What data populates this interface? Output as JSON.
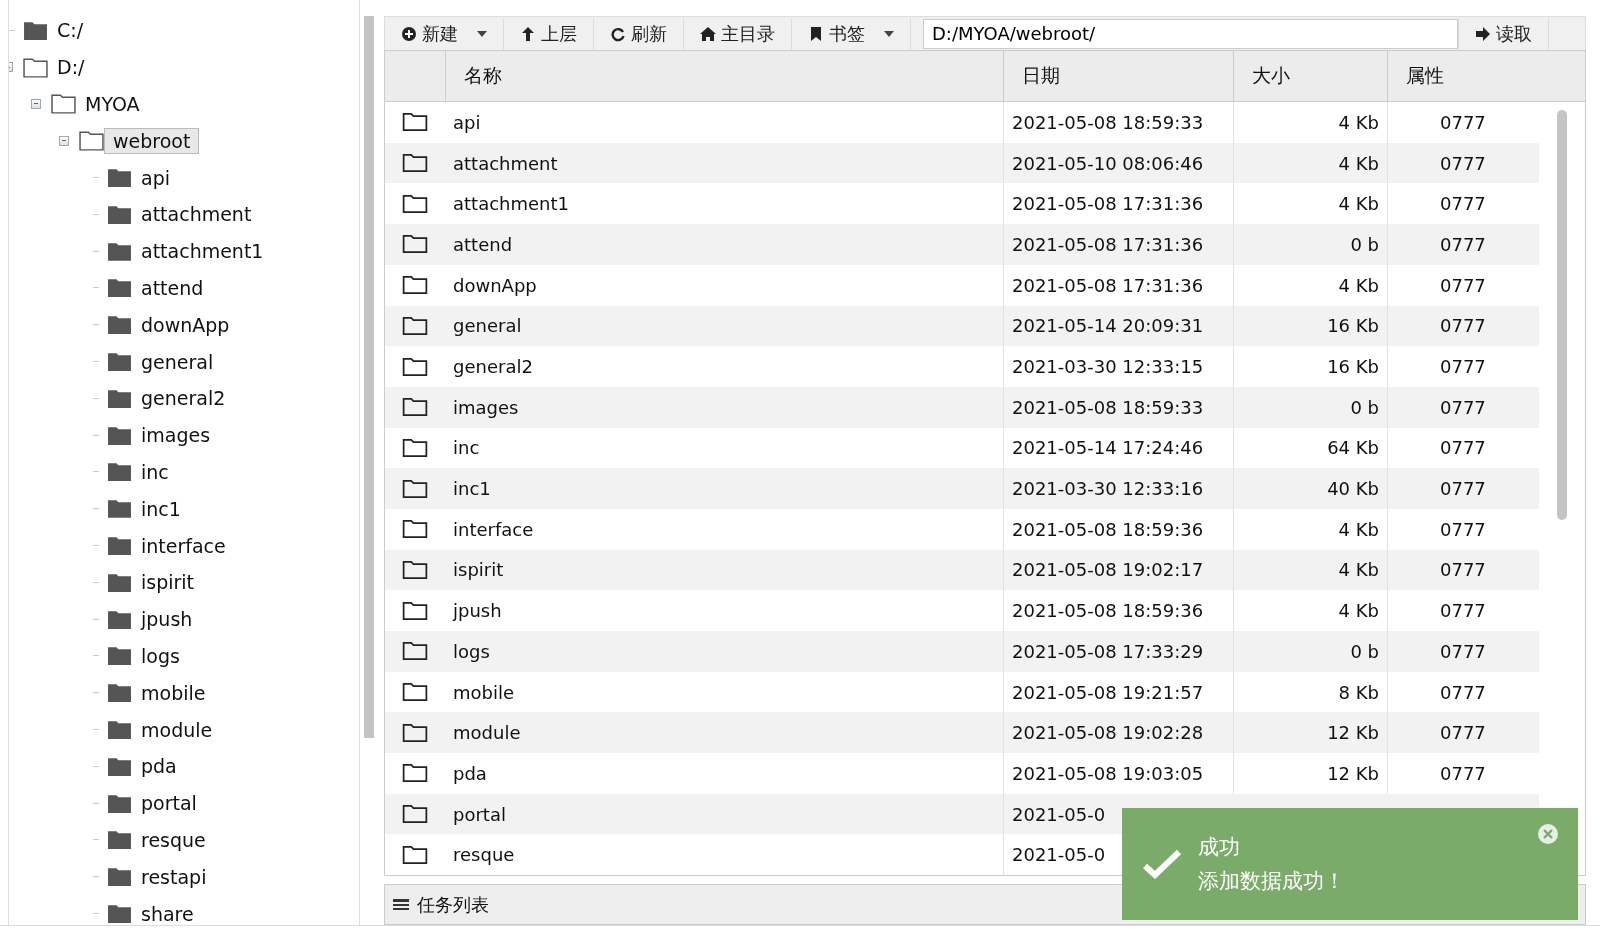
{
  "tree": [
    {
      "label": "C:/",
      "expanded": false,
      "selected": false
    },
    {
      "label": "D:/",
      "expanded": true,
      "selected": false,
      "children": [
        {
          "label": "MYOA",
          "expanded": true,
          "selected": false,
          "children": [
            {
              "label": "webroot",
              "expanded": true,
              "selected": true,
              "children": [
                {
                  "label": "api",
                  "expanded": false,
                  "selected": false
                },
                {
                  "label": "attachment",
                  "expanded": false,
                  "selected": false
                },
                {
                  "label": "attachment1",
                  "expanded": false,
                  "selected": false
                },
                {
                  "label": "attend",
                  "expanded": false,
                  "selected": false
                },
                {
                  "label": "downApp",
                  "expanded": false,
                  "selected": false
                },
                {
                  "label": "general",
                  "expanded": false,
                  "selected": false
                },
                {
                  "label": "general2",
                  "expanded": false,
                  "selected": false
                },
                {
                  "label": "images",
                  "expanded": false,
                  "selected": false
                },
                {
                  "label": "inc",
                  "expanded": false,
                  "selected": false
                },
                {
                  "label": "inc1",
                  "expanded": false,
                  "selected": false
                },
                {
                  "label": "interface",
                  "expanded": false,
                  "selected": false
                },
                {
                  "label": "ispirit",
                  "expanded": false,
                  "selected": false
                },
                {
                  "label": "jpush",
                  "expanded": false,
                  "selected": false
                },
                {
                  "label": "logs",
                  "expanded": false,
                  "selected": false
                },
                {
                  "label": "mobile",
                  "expanded": false,
                  "selected": false
                },
                {
                  "label": "module",
                  "expanded": false,
                  "selected": false
                },
                {
                  "label": "pda",
                  "expanded": false,
                  "selected": false
                },
                {
                  "label": "portal",
                  "expanded": false,
                  "selected": false
                },
                {
                  "label": "resque",
                  "expanded": false,
                  "selected": false
                },
                {
                  "label": "restapi",
                  "expanded": false,
                  "selected": false
                },
                {
                  "label": "share",
                  "expanded": false,
                  "selected": false
                }
              ]
            }
          ]
        }
      ]
    }
  ],
  "toolbar": [
    {
      "label": "新建",
      "dropdown": true
    },
    {
      "label": "上层",
      "dropdown": false
    },
    {
      "label": "刷新",
      "dropdown": false
    },
    {
      "label": "主目录",
      "dropdown": false
    },
    {
      "label": "书签",
      "dropdown": true
    }
  ],
  "path_field": {
    "value": "D:/MYOA/webroot/"
  },
  "read_button": {
    "label": "读取"
  },
  "table": {
    "columns": [
      "名称",
      "日期",
      "大小",
      "属性"
    ],
    "rows": [
      [
        "api",
        "2021-05-08 18:59:33",
        "4 Kb",
        "0777"
      ],
      [
        "attachment",
        "2021-05-10 08:06:46",
        "4 Kb",
        "0777"
      ],
      [
        "attachment1",
        "2021-05-08 17:31:36",
        "4 Kb",
        "0777"
      ],
      [
        "attend",
        "2021-05-08 17:31:36",
        "0 b",
        "0777"
      ],
      [
        "downApp",
        "2021-05-08 17:31:36",
        "4 Kb",
        "0777"
      ],
      [
        "general",
        "2021-05-14 20:09:31",
        "16 Kb",
        "0777"
      ],
      [
        "general2",
        "2021-03-30 12:33:15",
        "16 Kb",
        "0777"
      ],
      [
        "images",
        "2021-05-08 18:59:33",
        "0 b",
        "0777"
      ],
      [
        "inc",
        "2021-05-14 17:24:46",
        "64 Kb",
        "0777"
      ],
      [
        "inc1",
        "2021-03-30 12:33:16",
        "40 Kb",
        "0777"
      ],
      [
        "interface",
        "2021-05-08 18:59:36",
        "4 Kb",
        "0777"
      ],
      [
        "ispirit",
        "2021-05-08 19:02:17",
        "4 Kb",
        "0777"
      ],
      [
        "jpush",
        "2021-05-08 18:59:36",
        "4 Kb",
        "0777"
      ],
      [
        "logs",
        "2021-05-08 17:33:29",
        "0 b",
        "0777"
      ],
      [
        "mobile",
        "2021-05-08 19:21:57",
        "8 Kb",
        "0777"
      ],
      [
        "module",
        "2021-05-08 19:02:28",
        "12 Kb",
        "0777"
      ],
      [
        "pda",
        "2021-05-08 19:03:05",
        "12 Kb",
        "0777"
      ],
      [
        "portal",
        "2021-05-0"
      ],
      [
        "resque",
        "2021-05-0"
      ]
    ]
  },
  "task_panel": {
    "title": "任务列表"
  },
  "toast": {
    "title": "成功",
    "message": "添加数据成功！"
  }
}
